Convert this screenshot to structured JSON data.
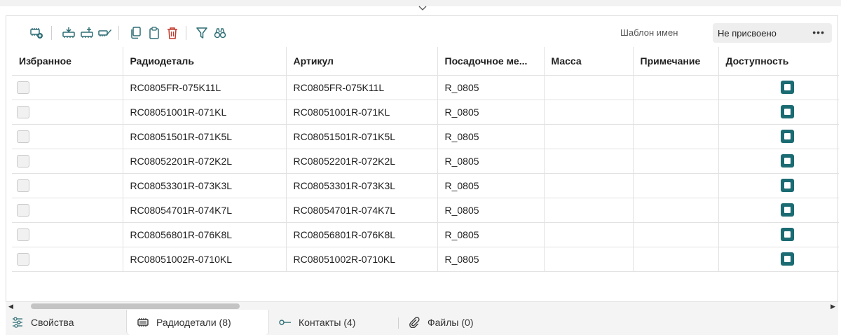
{
  "colors": {
    "accent": "#1b6b73",
    "icon": "#2e6e75",
    "delete": "#c0392b"
  },
  "toolbar": {
    "buttons": [
      "add-part-icon",
      "insert-part-icon",
      "import-part-icon",
      "edit-part-icon",
      "copy-icon",
      "paste-icon",
      "delete-icon",
      "filter-icon",
      "find-icon"
    ],
    "template_label": "Шаблон имен",
    "template_value": "Не присвоено",
    "more_label": "•••"
  },
  "table": {
    "columns": [
      "Избранное",
      "Радиодеталь",
      "Артикул",
      "Посадочное ме...",
      "Масса",
      "Примечание",
      "Доступность"
    ],
    "rows": [
      {
        "part": "RC0805FR-075K11L",
        "article": "RC0805FR-075K11L",
        "footprint": "R_0805",
        "mass": "",
        "note": ""
      },
      {
        "part": "RC08051001R-071KL",
        "article": "RC08051001R-071KL",
        "footprint": "R_0805",
        "mass": "",
        "note": ""
      },
      {
        "part": "RC08051501R-071K5L",
        "article": "RC08051501R-071K5L",
        "footprint": "R_0805",
        "mass": "",
        "note": ""
      },
      {
        "part": "RC08052201R-072K2L",
        "article": "RC08052201R-072K2L",
        "footprint": "R_0805",
        "mass": "",
        "note": ""
      },
      {
        "part": "RC08053301R-073K3L",
        "article": "RC08053301R-073K3L",
        "footprint": "R_0805",
        "mass": "",
        "note": ""
      },
      {
        "part": "RC08054701R-074K7L",
        "article": "RC08054701R-074K7L",
        "footprint": "R_0805",
        "mass": "",
        "note": ""
      },
      {
        "part": "RC08056801R-076K8L",
        "article": "RC08056801R-076K8L",
        "footprint": "R_0805",
        "mass": "",
        "note": ""
      },
      {
        "part": "RC08051002R-0710KL",
        "article": "RC08051002R-0710KL",
        "footprint": "R_0805",
        "mass": "",
        "note": ""
      }
    ]
  },
  "tabs": [
    {
      "label": "Свойства",
      "icon": "properties-icon"
    },
    {
      "label": "Радиодетали (8)",
      "icon": "chip-icon"
    },
    {
      "label": "Контакты (4)",
      "icon": "pin-icon"
    },
    {
      "label": "Файлы (0)",
      "icon": "paperclip-icon"
    }
  ]
}
